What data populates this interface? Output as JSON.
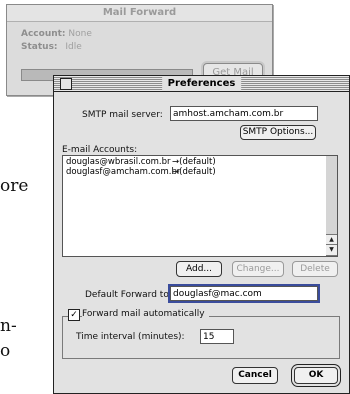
{
  "background_doc": {
    "fragments": [
      "ore",
      "n-",
      "o"
    ]
  },
  "mail_forward": {
    "title": "Mail Forward",
    "account_label": "Account:",
    "account_value": "None",
    "status_label": "Status:",
    "status_value": "Idle",
    "get_mail_label": "Get Mail"
  },
  "preferences": {
    "title": "Preferences",
    "smtp_label": "SMTP mail server:",
    "smtp_value": "amhost.amcham.com.br",
    "smtp_options_label": "SMTP Options...",
    "accounts_label": "E-mail Accounts:",
    "accounts": [
      {
        "address": "douglas@wbrasil.com.br",
        "target": "→(default)"
      },
      {
        "address": "douglasf@amcham.com.br",
        "target": "→(default)"
      }
    ],
    "add_label": "Add...",
    "change_label": "Change...",
    "delete_label": "Delete",
    "default_forward_label": "Default Forward to:",
    "default_forward_value": "douglasf@mac.com",
    "forward_auto_label": "Forward mail automatically",
    "forward_auto_checked": true,
    "interval_label": "Time interval (minutes):",
    "interval_value": "15",
    "cancel_label": "Cancel",
    "ok_label": "OK"
  }
}
